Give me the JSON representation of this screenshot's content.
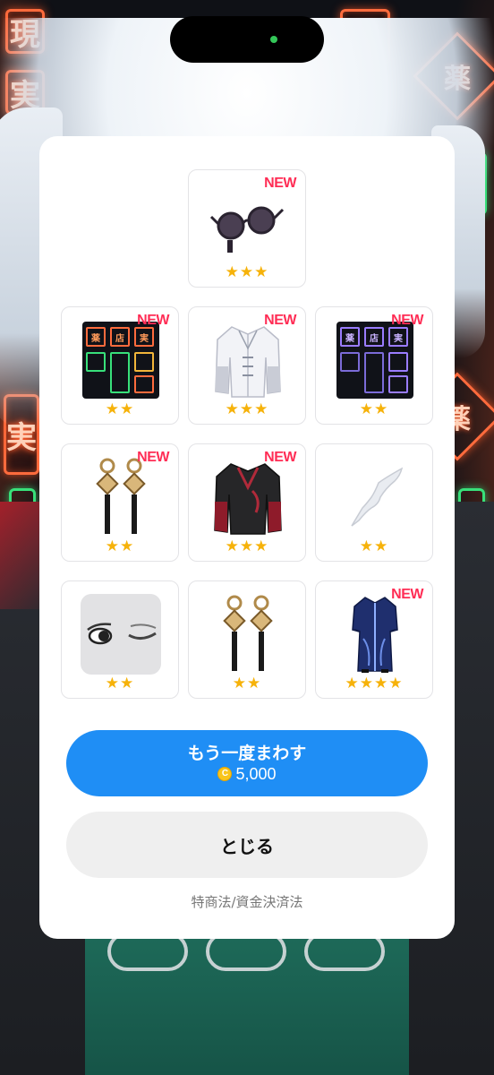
{
  "background": {
    "neon_signs": [
      "現",
      "実",
      "薬",
      "現",
      "実"
    ]
  },
  "status_indicator": {
    "color": "#34c759"
  },
  "items": [
    {
      "icon": "sunglasses-icon",
      "new_label": "NEW",
      "stars": "★★★"
    },
    {
      "icon": "neon-sign-orange-icon",
      "new_label": "NEW",
      "stars": "★★"
    },
    {
      "icon": "white-jacket-icon",
      "new_label": "NEW",
      "stars": "★★★"
    },
    {
      "icon": "neon-sign-purple-icon",
      "new_label": "NEW",
      "stars": "★★"
    },
    {
      "icon": "tassel-earrings-icon",
      "new_label": "NEW",
      "stars": "★★"
    },
    {
      "icon": "black-red-jacket-icon",
      "new_label": "NEW",
      "stars": "★★★"
    },
    {
      "icon": "white-hair-strand-icon",
      "new_label": "",
      "stars": "★★"
    },
    {
      "icon": "wink-eyes-icon",
      "new_label": "",
      "stars": "★★"
    },
    {
      "icon": "tassel-earrings-icon",
      "new_label": "",
      "stars": "★★"
    },
    {
      "icon": "blue-robe-icon",
      "new_label": "NEW",
      "stars": "★★★★"
    }
  ],
  "spin_again": {
    "label": "もう一度まわす",
    "coin_symbol": "C",
    "price": "5,000"
  },
  "close_button": {
    "label": "とじる"
  },
  "legal_link": "特商法/資金決済法",
  "colors": {
    "accent_blue": "#1f8ef5",
    "new_badge": "#ff2d55",
    "star": "#f6b20a"
  }
}
